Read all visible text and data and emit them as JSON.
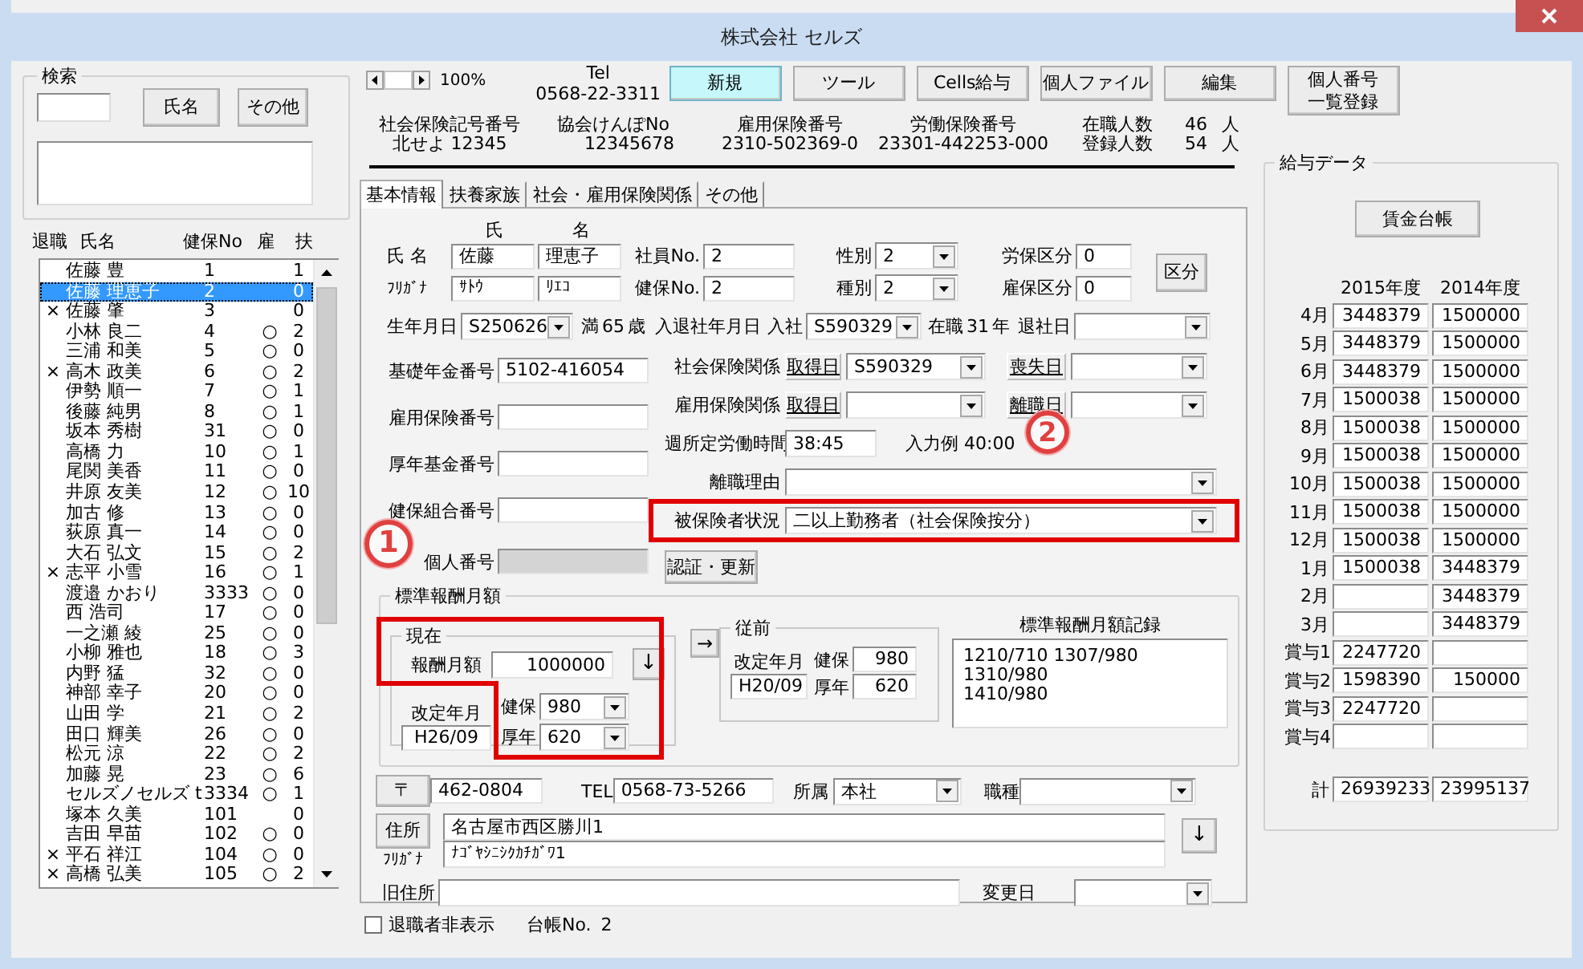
{
  "window": {
    "title": "株式会社 セルズ"
  },
  "search": {
    "title": "検索",
    "buttons": [
      "氏名",
      "その他"
    ]
  },
  "employee_list": {
    "columns": [
      "退職",
      "氏名",
      "健保No",
      "雇",
      "扶"
    ],
    "rows": [
      {
        "name": "佐藤 豊",
        "kenpo_no": "1",
        "dependents": "1",
        "selected": false
      },
      {
        "name": "佐藤 理恵子",
        "kenpo_no": "2",
        "dependents": "0",
        "selected": true
      },
      {
        "retired": "×",
        "name": "佐藤 肇",
        "kenpo_no": "3",
        "dependents": "0",
        "selected": false
      },
      {
        "name": "小林 良二",
        "kenpo_no": "4",
        "koyo": "○",
        "dependents": "2",
        "selected": false
      },
      {
        "name": "三浦 和美",
        "kenpo_no": "5",
        "koyo": "○",
        "dependents": "0",
        "selected": false
      },
      {
        "retired": "×",
        "name": "高木 政美",
        "kenpo_no": "6",
        "koyo": "○",
        "dependents": "2",
        "selected": false
      },
      {
        "name": "伊勢 順一",
        "kenpo_no": "7",
        "koyo": "○",
        "dependents": "1",
        "selected": false
      },
      {
        "name": "後藤 純男",
        "kenpo_no": "8",
        "koyo": "○",
        "dependents": "1",
        "selected": false
      },
      {
        "name": "坂本 秀樹",
        "kenpo_no": "31",
        "koyo": "○",
        "dependents": "0",
        "selected": false
      },
      {
        "name": "高橋 力",
        "kenpo_no": "10",
        "koyo": "○",
        "dependents": "1",
        "selected": false
      },
      {
        "name": "尾関 美香",
        "kenpo_no": "11",
        "koyo": "○",
        "dependents": "0",
        "selected": false
      },
      {
        "name": "井原 友美",
        "kenpo_no": "12",
        "koyo": "○",
        "dependents": "10",
        "selected": false
      },
      {
        "name": "加古 修",
        "kenpo_no": "13",
        "koyo": "○",
        "dependents": "0",
        "selected": false
      },
      {
        "name": "荻原 真一",
        "kenpo_no": "14",
        "koyo": "○",
        "dependents": "0",
        "selected": false
      },
      {
        "name": "大石 弘文",
        "kenpo_no": "15",
        "koyo": "○",
        "dependents": "2",
        "selected": false
      },
      {
        "retired": "×",
        "name": "志平 小雪",
        "kenpo_no": "16",
        "koyo": "○",
        "dependents": "1",
        "selected": false
      },
      {
        "name": "渡邉 かおり",
        "kenpo_no": "3333",
        "koyo": "○",
        "dependents": "0",
        "selected": false
      },
      {
        "name": "西 浩司",
        "kenpo_no": "17",
        "koyo": "○",
        "dependents": "0",
        "selected": false
      },
      {
        "name": "一之瀬 綾",
        "kenpo_no": "25",
        "koyo": "○",
        "dependents": "0",
        "selected": false
      },
      {
        "name": "小柳 雅也",
        "kenpo_no": "18",
        "koyo": "○",
        "dependents": "3",
        "selected": false
      },
      {
        "name": "内野 猛",
        "kenpo_no": "32",
        "koyo": "○",
        "dependents": "0",
        "selected": false
      },
      {
        "name": "神部 幸子",
        "kenpo_no": "20",
        "koyo": "○",
        "dependents": "0",
        "selected": false
      },
      {
        "name": "山田 学",
        "kenpo_no": "21",
        "koyo": "○",
        "dependents": "2",
        "selected": false
      },
      {
        "name": "田口 輝美",
        "kenpo_no": "26",
        "koyo": "○",
        "dependents": "0",
        "selected": false
      },
      {
        "name": "松元 涼",
        "kenpo_no": "22",
        "koyo": "○",
        "dependents": "2",
        "selected": false
      },
      {
        "name": "加藤 晃",
        "kenpo_no": "23",
        "koyo": "○",
        "dependents": "6",
        "selected": false
      },
      {
        "name": "セルズノセルズ t",
        "kenpo_no": "3334",
        "koyo": "○",
        "dependents": "1",
        "selected": false
      },
      {
        "name": "塚本 久美",
        "kenpo_no": "101",
        "dependents": "0",
        "selected": false
      },
      {
        "name": "吉田 早苗",
        "kenpo_no": "102",
        "koyo": "○",
        "dependents": "0",
        "selected": false
      },
      {
        "retired": "×",
        "name": "平石 祥江",
        "kenpo_no": "104",
        "koyo": "○",
        "dependents": "0",
        "selected": false
      },
      {
        "retired": "×",
        "name": "高橋 弘美",
        "kenpo_no": "105",
        "koyo": "○",
        "dependents": "2",
        "selected": false
      }
    ]
  },
  "toolbar": {
    "zoom": "100%",
    "tel_label": "Tel",
    "tel": "0568-22-3311",
    "buttons": [
      {
        "label": "新規",
        "selected": true
      },
      {
        "label": "ツール",
        "selected": false
      },
      {
        "label": "Cells給与",
        "selected": false
      },
      {
        "label": "個人ファイル",
        "selected": false
      },
      {
        "label": "編集",
        "selected": false
      },
      {
        "label": "個人番号一覧登録",
        "selected": false
      }
    ]
  },
  "company_info": [
    {
      "label": "社会保険記号番号",
      "value": "北せよ 12345"
    },
    {
      "label": "協会けんぽNo",
      "value": "12345678"
    },
    {
      "label": "雇用保険番号",
      "value": "2310-502369-0"
    },
    {
      "label": "労働保険番号",
      "value": "23301-442253-000"
    }
  ],
  "counts": [
    {
      "label": "在職人数",
      "value": "46",
      "unit": "人"
    },
    {
      "label": "登録人数",
      "value": "54",
      "unit": "人"
    }
  ],
  "tabs": [
    {
      "label": "基本情報",
      "selected": true
    },
    {
      "label": "扶養家族",
      "selected": false
    },
    {
      "label": "社会・雇用保険関係",
      "selected": false
    },
    {
      "label": "その他",
      "selected": false
    }
  ],
  "basic_info": {
    "name_heads": [
      "氏",
      "名"
    ],
    "name_row": {
      "label": "氏 名",
      "last": "佐藤",
      "first": "理恵子"
    },
    "kana_row": {
      "label": "ﾌﾘｶﾞﾅ",
      "last": "ｻﾄｳ",
      "first": "ﾘｴｺ"
    },
    "employee_no": {
      "label": "社員No.",
      "value": "2"
    },
    "kenpo_no": {
      "label": "健保No.",
      "value": "2"
    },
    "sex": {
      "label": "性別",
      "value": "2"
    },
    "category": {
      "label": "種別",
      "value": "2"
    },
    "rouho_class": {
      "label": "労保区分",
      "value": "0"
    },
    "koyo_class": {
      "label": "雇保区分",
      "value": "0"
    },
    "class_button": "区分",
    "birth": {
      "label": "生年月日",
      "value": "S250626"
    },
    "age": {
      "prefix": "満",
      "value": "65",
      "unit": "歳"
    },
    "join": {
      "title": "入退社年月日",
      "label": "入社",
      "value": "S590329"
    },
    "tenure": {
      "prefix": "在職",
      "value": "31",
      "unit": "年"
    },
    "leave": {
      "label": "退社日"
    },
    "numbers": [
      {
        "label": "基礎年金番号",
        "value": "5102-416054",
        "disabled": false
      },
      {
        "label": "雇用保険番号",
        "disabled": false
      },
      {
        "label": "厚年基金番号",
        "disabled": false
      },
      {
        "label": "健保組合番号",
        "disabled": false
      },
      {
        "label": "個人番号",
        "disabled": true
      }
    ],
    "social_insurance": {
      "label": "社会保険関係",
      "acquired_button": "取得日",
      "acquired": "S590329",
      "lost_button": "喪失日"
    },
    "employment_insurance": {
      "label": "雇用保険関係",
      "acquired_button": "取得日",
      "lost_button": "離職日"
    },
    "weekly_hours": {
      "label": "週所定労働時間",
      "value": "38:45",
      "hint": "入力例 40:00"
    },
    "leave_reason": {
      "label": "離職理由"
    },
    "insured_status": {
      "label": "被保険者状況",
      "value": "二以上勤務者（社会保険按分）"
    },
    "auth_button": "認証・更新"
  },
  "standard_pay": {
    "title": "標準報酬月額",
    "current": {
      "title": "現在",
      "pay_label": "報酬月額",
      "pay": "1000000",
      "down_button": "↓",
      "revision_label": "改定年月",
      "revision": "H26/09",
      "kenpo_label": "健保",
      "kenpo": "980",
      "kosei_label": "厚年",
      "kosei": "620"
    },
    "copy_button": "→",
    "previous": {
      "title": "従前",
      "revision_label": "改定年月",
      "revision": "H20/09",
      "kenpo_label": "健保",
      "kenpo": "980",
      "kosei_label": "厚年",
      "kosei": "620"
    },
    "record_title": "標準報酬月額記録",
    "record": "1210/710 1307/980 1310/980\n1410/980"
  },
  "address": {
    "zip_button": "〒",
    "zip": "462-0804",
    "tel_label": "TEL",
    "tel": "0568-73-5266",
    "dept_label": "所属",
    "dept": "本社",
    "job_label": "職種",
    "address_button": "住所",
    "kana_label": "ﾌﾘｶﾞﾅ",
    "address": "名古屋市西区勝川1",
    "address_kana": "ﾅｺﾞﾔｼﾆｼｸｶﾁｶﾞﾜ1",
    "down_button": "↓",
    "old_label": "旧住所",
    "change_label": "変更日"
  },
  "footer": {
    "hide_retired": {
      "label": "退職者非表示",
      "checked": false
    },
    "ledger_label": "台帳No.",
    "ledger_no": "2"
  },
  "salary": {
    "title": "給与データ",
    "ledger_button": "賃金台帳",
    "years": [
      "2015年度",
      "2014年度"
    ],
    "rows": [
      {
        "label": "4月",
        "this_year": "3448379",
        "last_year": "1500000"
      },
      {
        "label": "5月",
        "this_year": "3448379",
        "last_year": "1500000"
      },
      {
        "label": "6月",
        "this_year": "3448379",
        "last_year": "1500000"
      },
      {
        "label": "7月",
        "this_year": "1500038",
        "last_year": "1500000"
      },
      {
        "label": "8月",
        "this_year": "1500038",
        "last_year": "1500000"
      },
      {
        "label": "9月",
        "this_year": "1500038",
        "last_year": "1500000"
      },
      {
        "label": "10月",
        "this_year": "1500038",
        "last_year": "1500000"
      },
      {
        "label": "11月",
        "this_year": "1500038",
        "last_year": "1500000"
      },
      {
        "label": "12月",
        "this_year": "1500038",
        "last_year": "1500000"
      },
      {
        "label": "1月",
        "this_year": "1500038",
        "last_year": "3448379"
      },
      {
        "label": "2月",
        "last_year": "3448379"
      },
      {
        "label": "3月",
        "last_year": "3448379"
      },
      {
        "label": "賞与1",
        "this_year": "2247720"
      },
      {
        "label": "賞与2",
        "this_year": "1598390",
        "last_year": "150000"
      },
      {
        "label": "賞与3",
        "this_year": "2247720"
      },
      {
        "label": "賞与4"
      }
    ],
    "total": {
      "label": "計",
      "this_year": "26939233",
      "last_year": "23995137"
    }
  },
  "markers": [
    "1",
    "2"
  ]
}
